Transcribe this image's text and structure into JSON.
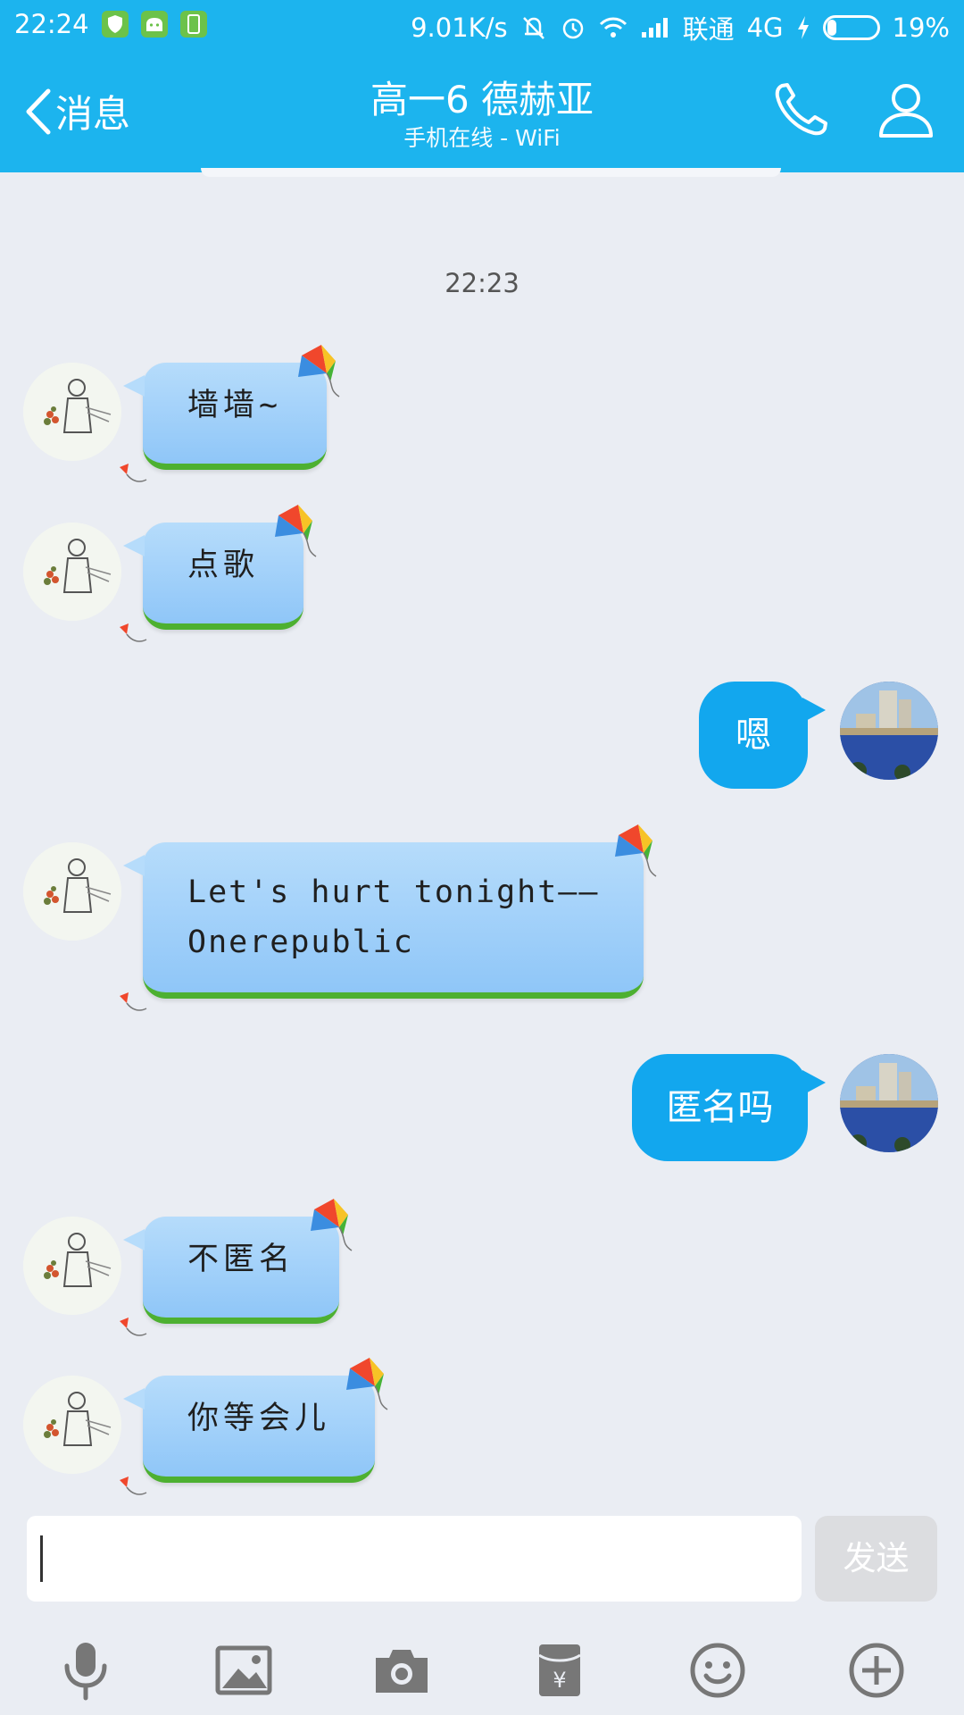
{
  "status_bar": {
    "time": "22:24",
    "speed": "9.01K/s",
    "carrier": "联通",
    "network": "4G",
    "battery": "19%",
    "battery_level": 0.19
  },
  "header": {
    "back_label": "消息",
    "title": "高一6 德赫亚",
    "subtitle": "手机在线 - WiFi",
    "color": "#1cb4ee"
  },
  "chat": {
    "timestamp": "22:23",
    "messages": [
      {
        "side": "left",
        "text": "墙墙~"
      },
      {
        "side": "left",
        "text": "点歌"
      },
      {
        "side": "right",
        "text": "嗯"
      },
      {
        "side": "left",
        "text": "Let's hurt tonight——\nOnerepublic"
      },
      {
        "side": "right",
        "text": "匿名吗"
      },
      {
        "side": "left",
        "text": "不匿名"
      },
      {
        "side": "left",
        "text": "你等会儿"
      }
    ]
  },
  "input": {
    "value": "",
    "send_label": "发送"
  },
  "toolbar": {
    "items": [
      "mic-icon",
      "image-icon",
      "camera-icon",
      "red-packet-icon",
      "emoji-icon",
      "plus-icon"
    ]
  },
  "colors": {
    "my_bubble": "#12a7ee",
    "background": "#eaedf3"
  }
}
